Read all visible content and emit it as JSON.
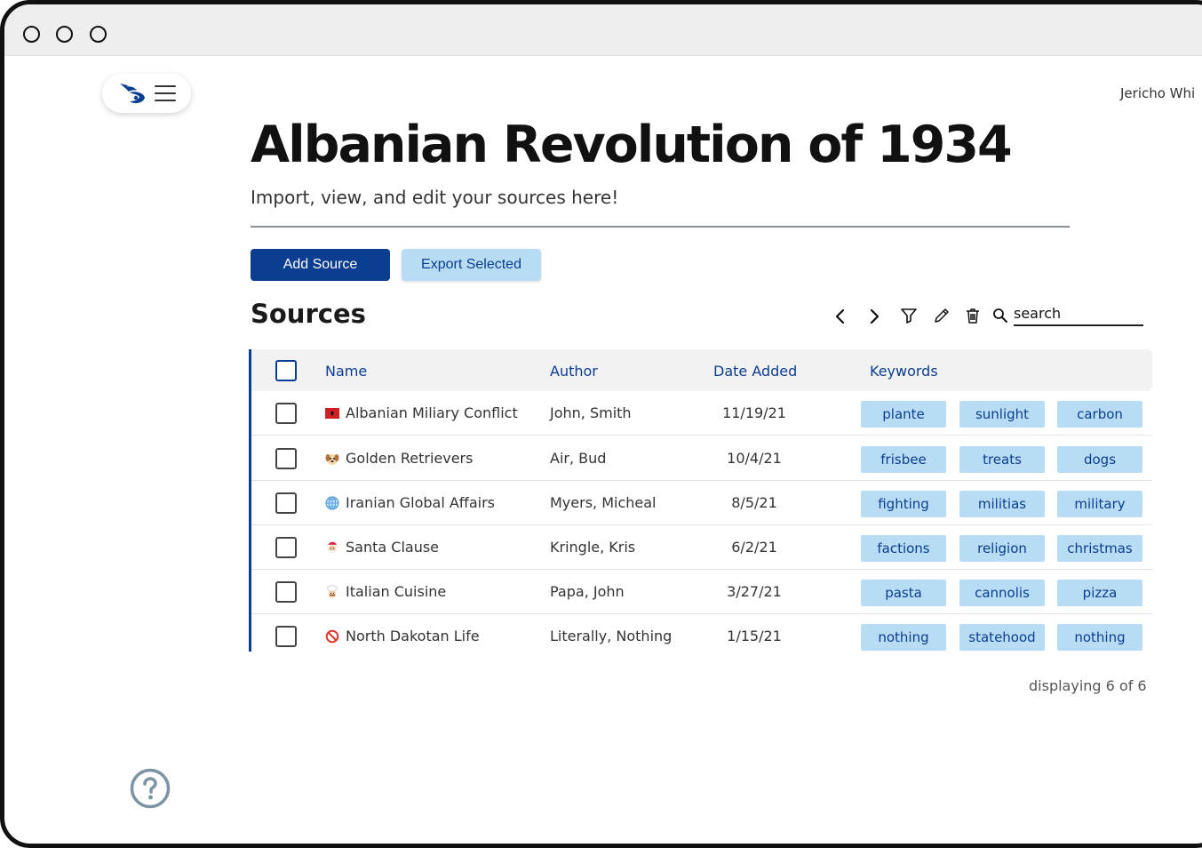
{
  "user": {
    "name": "Jericho Whi"
  },
  "header": {
    "title": "Albanian Revolution of 1934",
    "subtitle": "Import, view, and edit your sources here!"
  },
  "actions": {
    "add_source": "Add Source",
    "export_selected": "Export Selected"
  },
  "sources": {
    "title": "Sources",
    "search_placeholder": "search",
    "columns": [
      "Name",
      "Author",
      "Date Added",
      "Keywords"
    ],
    "rows": [
      {
        "icon": "albania-flag-icon",
        "name": "Albanian Miliary Conflict",
        "author": "John, Smith",
        "date": "11/19/21",
        "keywords": [
          "plante",
          "sunlight",
          "carbon"
        ]
      },
      {
        "icon": "dog-face-icon",
        "name": "Golden Retrievers",
        "author": "Air, Bud",
        "date": "10/4/21",
        "keywords": [
          "frisbee",
          "treats",
          "dogs"
        ]
      },
      {
        "icon": "globe-icon",
        "name": "Iranian Global Affairs",
        "author": "Myers, Micheal",
        "date": "8/5/21",
        "keywords": [
          "fighting",
          "militias",
          "military"
        ]
      },
      {
        "icon": "santa-icon",
        "name": "Santa Clause",
        "author": "Kringle, Kris",
        "date": "6/2/21",
        "keywords": [
          "factions",
          "religion",
          "christmas"
        ]
      },
      {
        "icon": "chef-icon",
        "name": "Italian Cuisine",
        "author": "Papa, John",
        "date": "3/27/21",
        "keywords": [
          "pasta",
          "cannolis",
          "pizza"
        ]
      },
      {
        "icon": "prohibited-icon",
        "name": "North Dakotan Life",
        "author": "Literally, Nothing",
        "date": "1/15/21",
        "keywords": [
          "nothing",
          "statehood",
          "nothing"
        ]
      }
    ],
    "display_count": "displaying 6 of 6"
  },
  "colors": {
    "primary": "#0b3d91",
    "tag_bg": "#b8dcf3",
    "header_bg": "#f2f2f2",
    "help": "#7c93a3"
  }
}
